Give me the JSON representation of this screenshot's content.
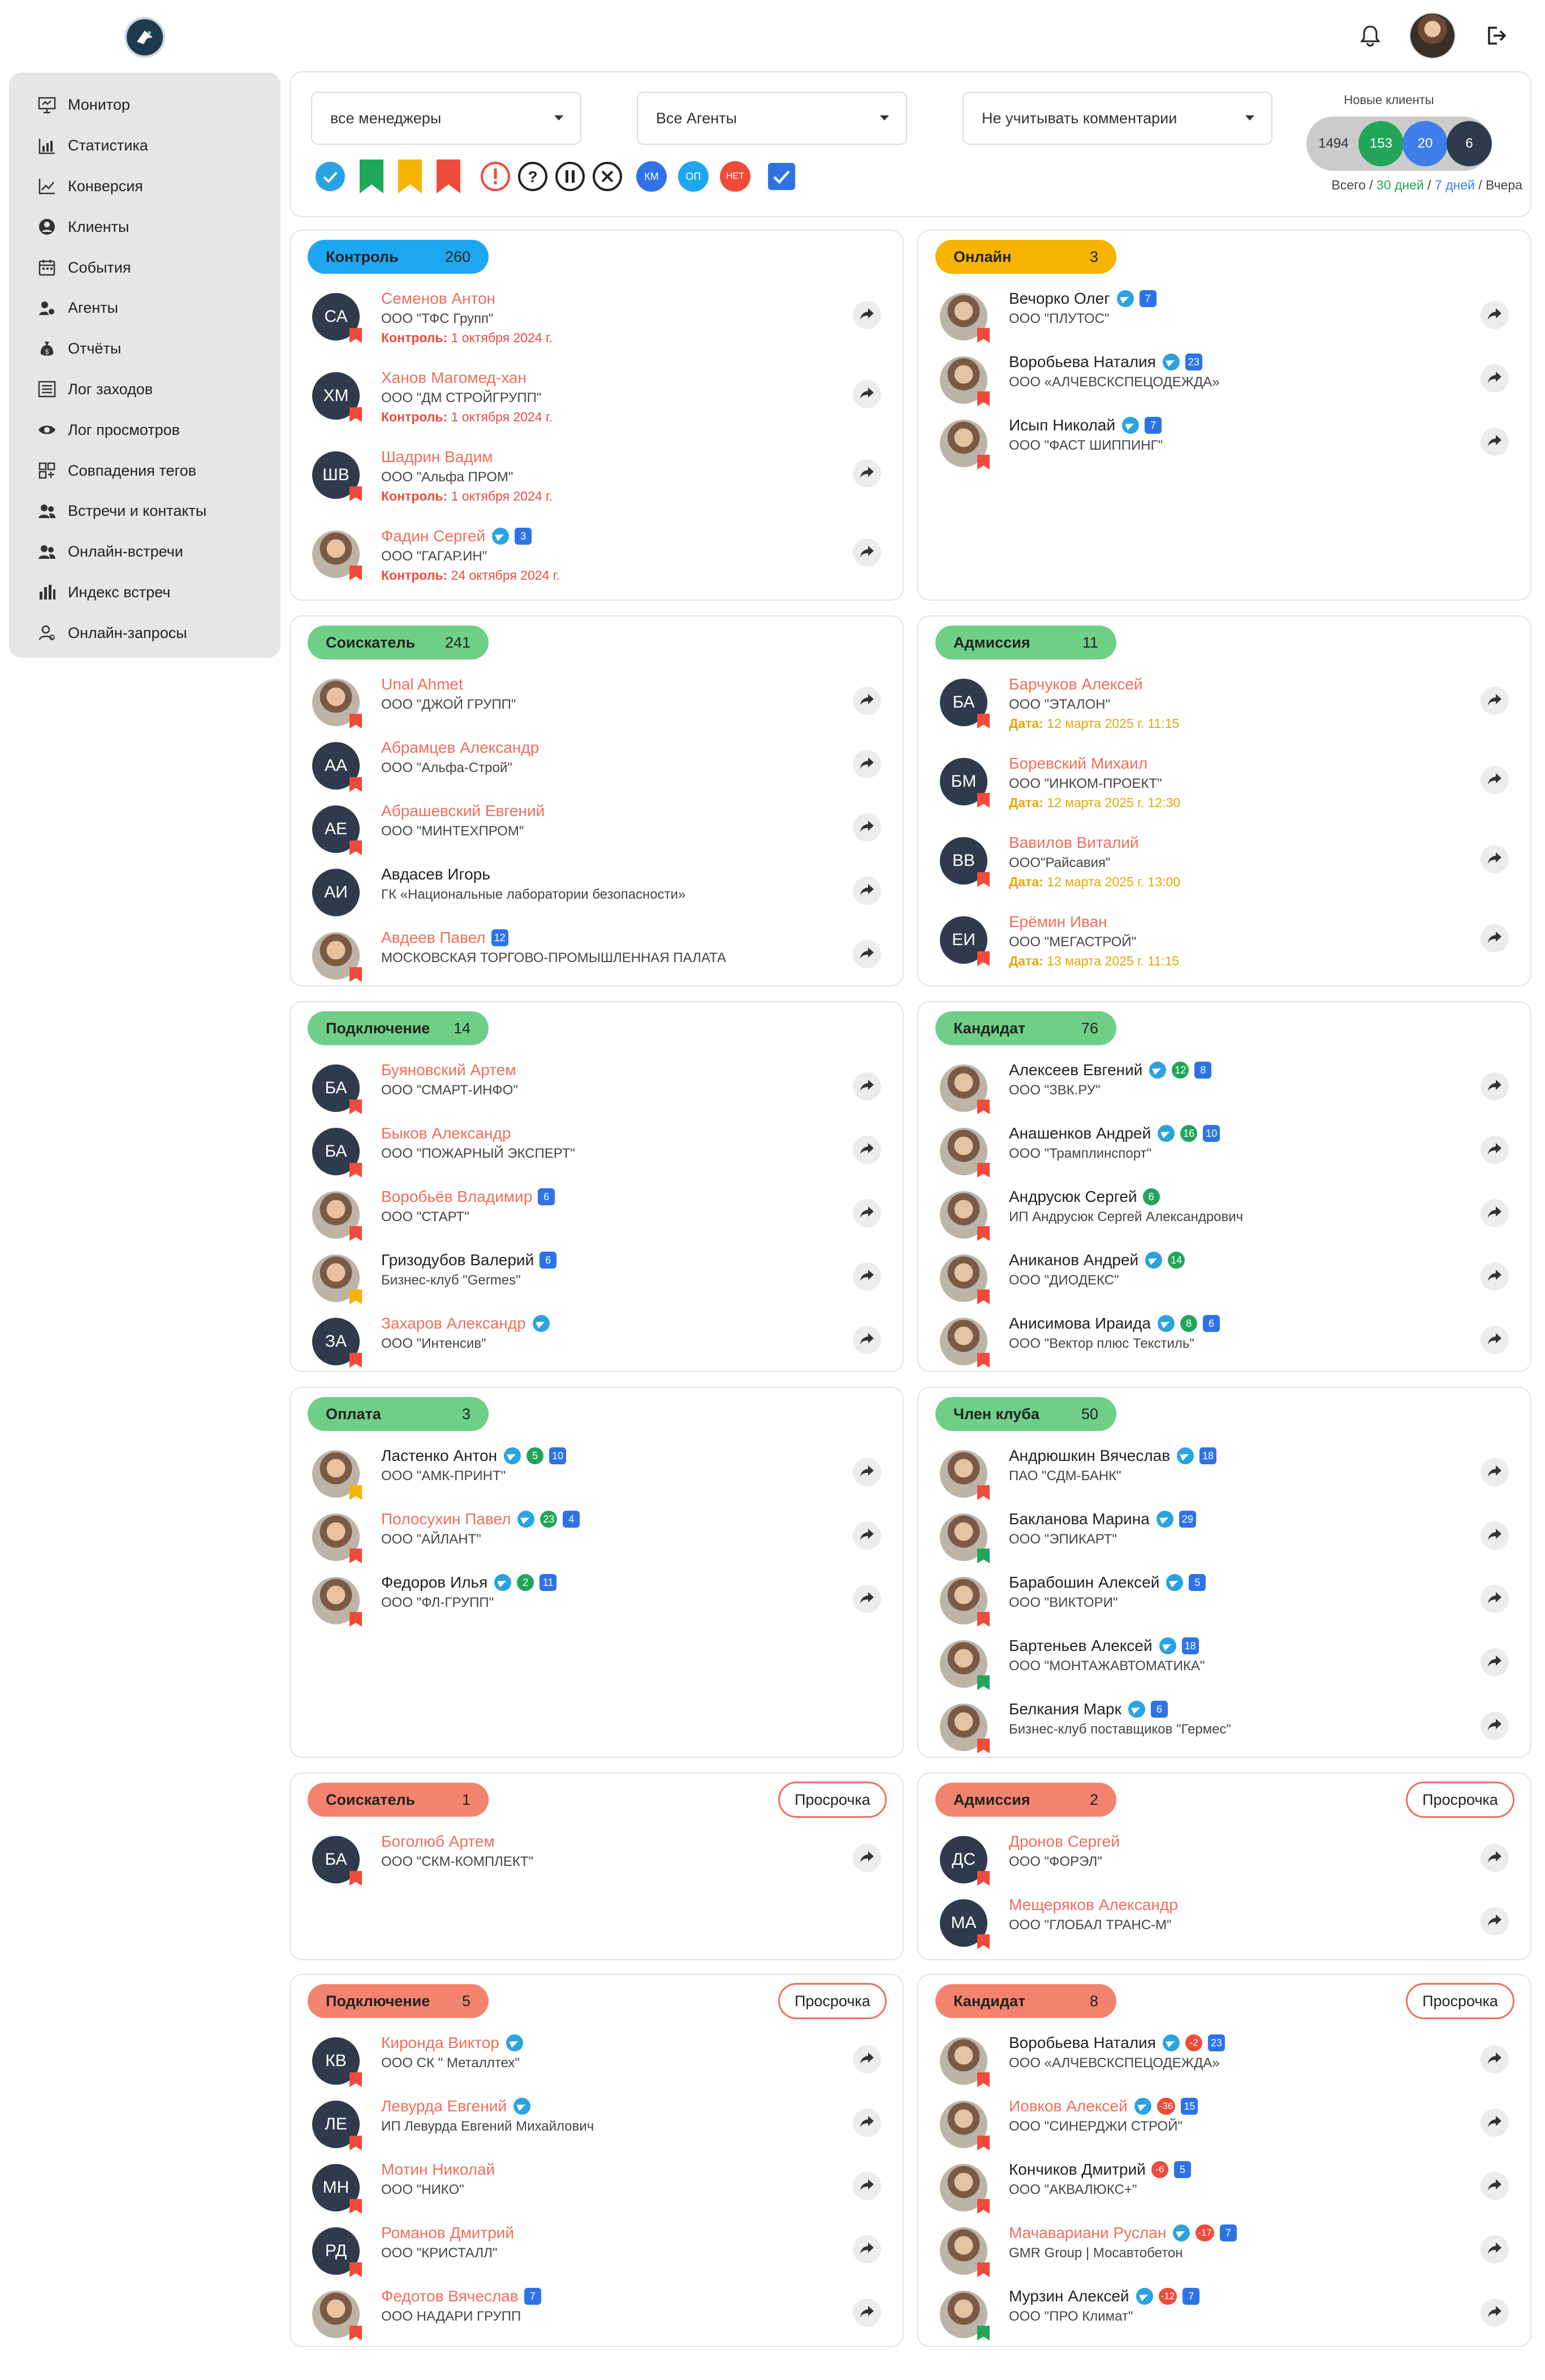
{
  "header": {
    "logo": "company-logo",
    "bell": "bell-icon",
    "avatar": "user-avatar",
    "logout": "logout-icon"
  },
  "nav": [
    {
      "label": "Монитор",
      "icon": "monitor-icon"
    },
    {
      "label": "Статистика",
      "icon": "chart-icon"
    },
    {
      "label": "Конверсия",
      "icon": "conversion-icon"
    },
    {
      "label": "Клиенты",
      "icon": "user-circle-icon"
    },
    {
      "label": "События",
      "icon": "calendar-icon"
    },
    {
      "label": "Агенты",
      "icon": "agents-icon"
    },
    {
      "label": "Отчёты",
      "icon": "money-bag-icon"
    },
    {
      "label": "Лог заходов",
      "icon": "list-icon"
    },
    {
      "label": "Лог просмотров",
      "icon": "eye-icon"
    },
    {
      "label": "Совпадения тегов",
      "icon": "tags-icon"
    },
    {
      "label": "Встречи и контакты",
      "icon": "people-icon"
    },
    {
      "label": "Онлайн-встречи",
      "icon": "people-icon"
    },
    {
      "label": "Индекс встреч",
      "icon": "bars-icon"
    },
    {
      "label": "Онлайн-запросы",
      "icon": "user-outline-icon"
    }
  ],
  "filters": {
    "managers": "все менеджеры",
    "agents": "Все Агенты",
    "comments": "Не учитывать комментарии",
    "icon_labels": {
      "km": "КМ",
      "op": "ОП",
      "net": "НЕТ"
    }
  },
  "new_clients": {
    "title": "Новые клиенты",
    "total": "1494",
    "d30": "153",
    "d7": "20",
    "yesterday": "6",
    "legend": {
      "total": "Всего",
      "d30": "30 дней",
      "d7": "7 дней",
      "yesterday": "Вчера",
      "sep": " / "
    },
    "colors": {
      "d30": "#22a559",
      "d7": "#3d7ee8",
      "yesterday": "#2f3a4c"
    }
  },
  "cards": [
    {
      "title": "Контроль",
      "count": "260",
      "color": "#1ea7f0",
      "overdue": "",
      "rows": [
        {
          "initials": "СА",
          "name": "Семенов Антон",
          "red": true,
          "org": "ООО \"ТФС Групп\"",
          "date_label": "Контроль:",
          "date": "1 октября 2024 г.",
          "date_color": "#ee4b3b",
          "flag": "#ee4b3b",
          "badges": []
        },
        {
          "initials": "ХМ",
          "name": "Ханов Магомед-хан",
          "red": true,
          "org": "ООО \"ДМ СТРОЙГРУПП\"",
          "date_label": "Контроль:",
          "date": "1 октября 2024 г.",
          "date_color": "#ee4b3b",
          "flag": "#ee4b3b",
          "badges": []
        },
        {
          "initials": "ШВ",
          "name": "Шадрин Вадим",
          "red": true,
          "org": "ООО \"Альфа ПРОМ\"",
          "date_label": "Контроль:",
          "date": "1 октября 2024 г.",
          "date_color": "#ee4b3b",
          "flag": "#ee4b3b",
          "badges": []
        },
        {
          "initials": "",
          "photo": true,
          "name": "Фадин Сергей",
          "red": true,
          "org": "ООО \"ГАГАР.ИН\"",
          "date_label": "Контроль:",
          "date": "24 октября 2024 г.",
          "date_color": "#ee4b3b",
          "flag": "#ee4b3b",
          "badges": [
            {
              "t": "tg"
            },
            {
              "t": "bx",
              "v": "3"
            }
          ]
        }
      ]
    },
    {
      "title": "Онлайн",
      "count": "3",
      "color": "#f6b400",
      "overdue": "",
      "rows": [
        {
          "photo": true,
          "name": "Вечорко Олег",
          "red": false,
          "org": "ООО \"ПЛУТОС\"",
          "flag": "#ee4b3b",
          "badges": [
            {
              "t": "tg"
            },
            {
              "t": "bx",
              "v": "7"
            }
          ]
        },
        {
          "photo": true,
          "name": "Воробьева Наталия",
          "red": false,
          "org": "ООО «АЛЧЕВСКСПЕЦОДЕЖДА»",
          "flag": "#ee4b3b",
          "badges": [
            {
              "t": "tg"
            },
            {
              "t": "bx",
              "v": "23"
            }
          ]
        },
        {
          "photo": true,
          "name": "Исып Николай",
          "red": false,
          "org": "ООО \"ФАСТ ШИППИНГ\"",
          "flag": "#ee4b3b",
          "badges": [
            {
              "t": "tg"
            },
            {
              "t": "bx",
              "v": "7"
            }
          ]
        }
      ]
    },
    {
      "title": "Соискатель",
      "count": "241",
      "color": "#6fcf86",
      "overdue": "",
      "rows": [
        {
          "photo": true,
          "name": "Unal Ahmet",
          "red": true,
          "org": "ООО \"ДЖОЙ ГРУПП\"",
          "flag": "#ee4b3b",
          "badges": []
        },
        {
          "initials": "АА",
          "name": "Абрамцев Александр",
          "red": true,
          "org": "ООО \"Альфа-Строй\"",
          "flag": "#ee4b3b",
          "badges": []
        },
        {
          "initials": "АЕ",
          "name": "Абрашевский Евгений",
          "red": true,
          "org": "ООО \"МИНТЕХПРОМ\"",
          "flag": "#ee4b3b",
          "badges": []
        },
        {
          "initials": "АИ",
          "name": "Авдасев Игорь",
          "red": false,
          "org": "ГК «Национальные лаборатории безопасности»",
          "flag": "",
          "badges": []
        },
        {
          "photo": true,
          "name": "Авдеев Павел",
          "red": true,
          "org": "МОСКОВСКАЯ ТОРГОВО-ПРОМЫШЛЕННАЯ ПАЛАТА",
          "flag": "#ee4b3b",
          "badges": [
            {
              "t": "bx",
              "v": "12"
            }
          ]
        }
      ]
    },
    {
      "title": "Адмиссия",
      "count": "11",
      "color": "#6fcf86",
      "overdue": "",
      "rows": [
        {
          "initials": "БА",
          "name": "Барчуков Алексей",
          "red": true,
          "org": "ООО \"ЭТАЛОН\"",
          "date_label": "Дата:",
          "date": "12 марта 2025 г. 11:15",
          "date_color": "#e8a600",
          "flag": "#ee4b3b",
          "badges": []
        },
        {
          "initials": "БМ",
          "name": "Боревский Михаил",
          "red": true,
          "org": "ООО \"ИНКОМ-ПРОЕКТ\"",
          "date_label": "Дата:",
          "date": "12 марта 2025 г. 12:30",
          "date_color": "#e8a600",
          "flag": "#ee4b3b",
          "badges": []
        },
        {
          "initials": "ВВ",
          "name": "Вавилов Виталий",
          "red": true,
          "org": "ООО\"Райсавия\"",
          "date_label": "Дата:",
          "date": "12 марта 2025 г. 13:00",
          "date_color": "#e8a600",
          "flag": "#ee4b3b",
          "badges": []
        },
        {
          "initials": "ЕИ",
          "name": "Ерёмин Иван",
          "red": true,
          "org": "ООО \"МЕГАСТРОЙ\"",
          "date_label": "Дата:",
          "date": "13 марта 2025 г. 11:15",
          "date_color": "#e8a600",
          "flag": "#ee4b3b",
          "badges": []
        }
      ]
    },
    {
      "title": "Подключение",
      "count": "14",
      "color": "#6fcf86",
      "overdue": "",
      "rows": [
        {
          "initials": "БА",
          "name": "Буяновский Артем",
          "red": true,
          "org": "ООО \"СМАРТ-ИНФО\"",
          "flag": "#ee4b3b",
          "badges": []
        },
        {
          "initials": "БА",
          "name": "Быков Александр",
          "red": true,
          "org": "ООО \"ПОЖАРНЫЙ ЭКСПЕРТ\"",
          "flag": "#ee4b3b",
          "badges": []
        },
        {
          "photo": true,
          "name": "Воробьёв Владимир",
          "red": true,
          "org": "ООО \"СТАРТ\"",
          "flag": "#ee4b3b",
          "badges": [
            {
              "t": "bx",
              "v": "6"
            }
          ]
        },
        {
          "photo": true,
          "name": "Гризодубов Валерий",
          "red": false,
          "org": "Бизнес-клуб \"Germes\"",
          "flag": "#f6b400",
          "badges": [
            {
              "t": "bx",
              "v": "6"
            }
          ]
        },
        {
          "initials": "ЗА",
          "name": "Захаров Александр",
          "red": true,
          "org": "ООО \"Интенсив\"",
          "flag": "#ee4b3b",
          "badges": [
            {
              "t": "tg"
            }
          ]
        }
      ]
    },
    {
      "title": "Кандидат",
      "count": "76",
      "color": "#6fcf86",
      "overdue": "",
      "rows": [
        {
          "photo": true,
          "name": "Алексеев Евгений",
          "red": false,
          "org": "ООО \"ЗВК.РУ\"",
          "flag": "#ee4b3b",
          "badges": [
            {
              "t": "tg"
            },
            {
              "t": "gc",
              "v": "12"
            },
            {
              "t": "bx",
              "v": "8"
            }
          ]
        },
        {
          "photo": true,
          "name": "Анашенков Андрей",
          "red": false,
          "org": "ООО \"Трамплинспорт\"",
          "flag": "#ee4b3b",
          "badges": [
            {
              "t": "tg"
            },
            {
              "t": "gc",
              "v": "16"
            },
            {
              "t": "bx",
              "v": "10"
            }
          ]
        },
        {
          "photo": true,
          "name": "Андрусюк Сергей",
          "red": false,
          "org": "ИП Андрусюк Сергей Александрович",
          "flag": "#ee4b3b",
          "badges": [
            {
              "t": "gc",
              "v": "6"
            }
          ]
        },
        {
          "photo": true,
          "name": "Аниканов Андрей",
          "red": false,
          "org": "ООО \"ДИОДЕКС\"",
          "flag": "#ee4b3b",
          "badges": [
            {
              "t": "tg"
            },
            {
              "t": "gc",
              "v": "14"
            }
          ]
        },
        {
          "photo": true,
          "name": "Анисимова Ираида",
          "red": false,
          "org": "ООО \"Вектор плюс Текстиль\"",
          "flag": "#ee4b3b",
          "badges": [
            {
              "t": "tg"
            },
            {
              "t": "gc",
              "v": "8"
            },
            {
              "t": "bx",
              "v": "6"
            }
          ]
        }
      ]
    },
    {
      "title": "Оплата",
      "count": "3",
      "color": "#6fcf86",
      "overdue": "",
      "rows": [
        {
          "photo": true,
          "name": "Ластенко Антон",
          "red": false,
          "org": "ООО \"АМК-ПРИНТ\"",
          "flag": "#f6b400",
          "badges": [
            {
              "t": "tg"
            },
            {
              "t": "gc",
              "v": "5"
            },
            {
              "t": "bx",
              "v": "10"
            }
          ]
        },
        {
          "photo": true,
          "name": "Полосухин Павел",
          "red": true,
          "org": "ООО \"АЙЛАНТ\"",
          "flag": "#ee4b3b",
          "badges": [
            {
              "t": "tg"
            },
            {
              "t": "gc",
              "v": "23"
            },
            {
              "t": "bx",
              "v": "4"
            }
          ]
        },
        {
          "photo": true,
          "name": "Федоров Илья",
          "red": false,
          "org": "ООО \"ФЛ-ГРУПП\"",
          "flag": "#ee4b3b",
          "badges": [
            {
              "t": "tg"
            },
            {
              "t": "gc",
              "v": "2"
            },
            {
              "t": "bx",
              "v": "11"
            }
          ]
        }
      ]
    },
    {
      "title": "Член клуба",
      "count": "50",
      "color": "#6fcf86",
      "overdue": "",
      "rows": [
        {
          "photo": true,
          "name": "Андрюшкин Вячеслав",
          "red": false,
          "org": "ПАО \"СДМ-БАНК\"",
          "flag": "#ee4b3b",
          "badges": [
            {
              "t": "tg"
            },
            {
              "t": "bx",
              "v": "18"
            }
          ]
        },
        {
          "photo": true,
          "name": "Бакланова Марина",
          "red": false,
          "org": "ООО \"ЭПИКАРТ\"",
          "flag": "#22a559",
          "badges": [
            {
              "t": "tg"
            },
            {
              "t": "bx",
              "v": "29"
            }
          ]
        },
        {
          "photo": true,
          "name": "Барабошин Алексей",
          "red": false,
          "org": "ООО \"ВИКТОРИ\"",
          "flag": "#ee4b3b",
          "badges": [
            {
              "t": "tg"
            },
            {
              "t": "bx",
              "v": "5"
            }
          ]
        },
        {
          "photo": true,
          "name": "Бартеньев Алексей",
          "red": false,
          "org": "ООО \"МОНТАЖАВТОМАТИКА\"",
          "flag": "#22a559",
          "badges": [
            {
              "t": "tg"
            },
            {
              "t": "bx",
              "v": "18"
            }
          ]
        },
        {
          "photo": true,
          "name": "Белкания Марк",
          "red": false,
          "org": "Бизнес-клуб поставщиков \"Гермес\"",
          "flag": "#ee4b3b",
          "badges": [
            {
              "t": "tg"
            },
            {
              "t": "bx",
              "v": "6"
            }
          ]
        }
      ]
    },
    {
      "title": "Соискатель",
      "count": "1",
      "color": "#f2836f",
      "overdue": "Просрочка",
      "rows": [
        {
          "initials": "БА",
          "name": "Боголюб Артем",
          "red": true,
          "org": "ООО \"СКМ-КОМПЛЕКТ\"",
          "flag": "#ee4b3b",
          "badges": []
        }
      ]
    },
    {
      "title": "Адмиссия",
      "count": "2",
      "color": "#f2836f",
      "overdue": "Просрочка",
      "rows": [
        {
          "initials": "ДС",
          "name": "Дронов Сергей",
          "red": true,
          "org": "ООО \"ФОРЭЛ\"",
          "flag": "#ee4b3b",
          "badges": []
        },
        {
          "initials": "МА",
          "name": "Мещеряков Александр",
          "red": true,
          "org": "ООО \"ГЛОБАЛ ТРАНС-М\"",
          "flag": "#ee4b3b",
          "badges": []
        }
      ]
    },
    {
      "title": "Подключение",
      "count": "5",
      "color": "#f2836f",
      "overdue": "Просрочка",
      "rows": [
        {
          "initials": "КВ",
          "name": "Киронда Виктор",
          "red": true,
          "org": "ООО СК \" Металлтех\"",
          "flag": "#ee4b3b",
          "badges": [
            {
              "t": "tg"
            }
          ]
        },
        {
          "initials": "ЛЕ",
          "name": "Левурда Евгений",
          "red": true,
          "org": "ИП Левурда Евгений Михайлович",
          "flag": "#ee4b3b",
          "badges": [
            {
              "t": "tg"
            }
          ]
        },
        {
          "initials": "МН",
          "name": "Мотин Николай",
          "red": true,
          "org": "ООО \"НИКО\"",
          "flag": "#ee4b3b",
          "badges": []
        },
        {
          "initials": "РД",
          "name": "Романов Дмитрий",
          "red": true,
          "org": "ООО \"КРИСТАЛЛ\"",
          "flag": "#ee4b3b",
          "badges": []
        },
        {
          "photo": true,
          "name": "Федотов Вячеслав",
          "red": true,
          "org": "ООО НАДАРИ ГРУПП",
          "flag": "#ee4b3b",
          "badges": [
            {
              "t": "bx",
              "v": "7"
            }
          ]
        }
      ]
    },
    {
      "title": "Кандидат",
      "count": "8",
      "color": "#f2836f",
      "overdue": "Просрочка",
      "rows": [
        {
          "photo": true,
          "name": "Воробьева Наталия",
          "red": false,
          "org": "ООО «АЛЧЕВСКСПЕЦОДЕЖДА»",
          "flag": "#ee4b3b",
          "badges": [
            {
              "t": "tg"
            },
            {
              "t": "rc",
              "v": "-2"
            },
            {
              "t": "bx",
              "v": "23"
            }
          ]
        },
        {
          "photo": true,
          "name": "Иовков Алексей",
          "red": true,
          "org": "ООО \"СИНЕРДЖИ СТРОЙ\"",
          "flag": "#ee4b3b",
          "badges": [
            {
              "t": "tg"
            },
            {
              "t": "rc",
              "v": "-36"
            },
            {
              "t": "bx",
              "v": "15"
            }
          ]
        },
        {
          "photo": true,
          "name": "Кончиков Дмитрий",
          "red": false,
          "org": "ООО \"АКВАЛЮКС+\"",
          "flag": "#ee4b3b",
          "badges": [
            {
              "t": "rc",
              "v": "-6"
            },
            {
              "t": "bx",
              "v": "5"
            }
          ]
        },
        {
          "photo": true,
          "name": "Мачавариани Руслан",
          "red": true,
          "org": "GMR Group | Мосавтобетон",
          "flag": "#ee4b3b",
          "badges": [
            {
              "t": "tg"
            },
            {
              "t": "rc",
              "v": "-17"
            },
            {
              "t": "bx",
              "v": "7"
            }
          ]
        },
        {
          "photo": true,
          "name": "Мурзин Алексей",
          "red": false,
          "org": "ООО \"ПРО Климат\"",
          "flag": "#22a559",
          "badges": [
            {
              "t": "tg"
            },
            {
              "t": "rc",
              "v": "-12"
            },
            {
              "t": "bx",
              "v": "7"
            }
          ]
        }
      ]
    }
  ]
}
